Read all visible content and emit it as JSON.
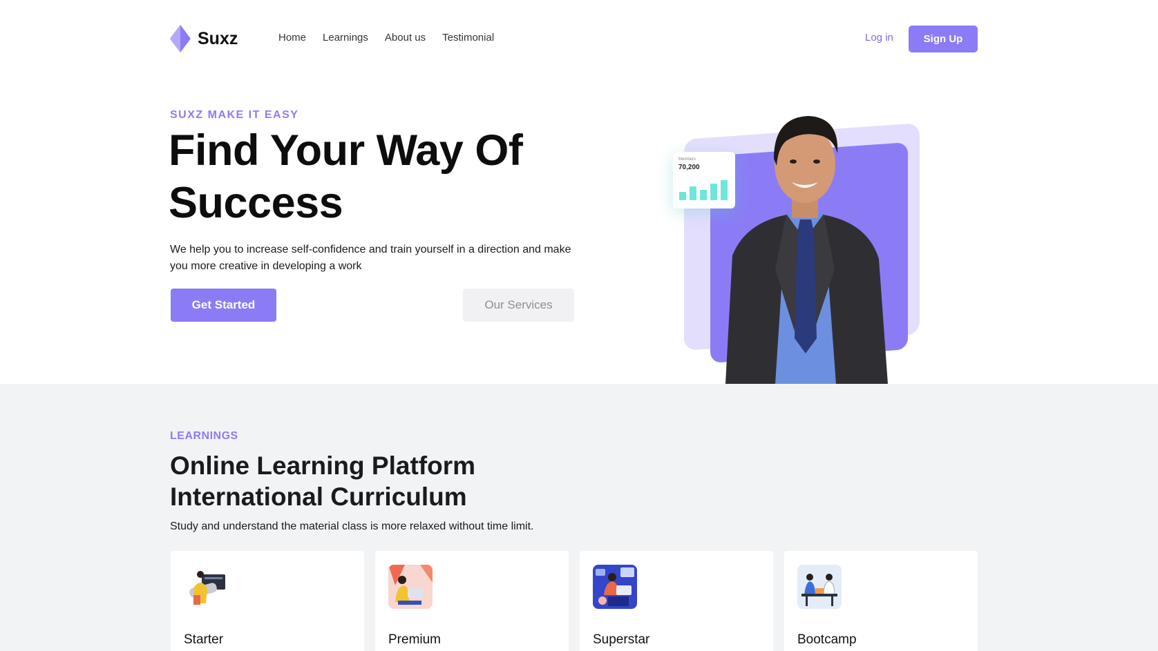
{
  "brand": {
    "name": "Suxz",
    "accent": "#8b7cf6"
  },
  "nav": {
    "links": [
      "Home",
      "Learnings",
      "About us",
      "Testimonial"
    ],
    "login": "Log in",
    "signup": "Sign Up"
  },
  "hero": {
    "eyebrow": "SUXZ MAKE IT EASY",
    "title_line1": "Find Your Way Of",
    "title_line2": "Success",
    "description": "We help you to increase self-confidence and train yourself in a direction and make you more creative in developing a work",
    "primary_button": "Get Started",
    "secondary_button": "Our Services",
    "stat_card": {
      "label": "Members",
      "value": "70,200",
      "bar_levels": [
        0.35,
        0.6,
        0.45,
        0.7,
        0.85
      ]
    }
  },
  "learnings": {
    "eyebrow": "LEARNINGS",
    "title_line1": "Online Learning Platform",
    "title_line2": "International Curriculum",
    "description": "Study and understand the material class is more relaxed without time limit.",
    "cards": [
      {
        "title": "Starter",
        "icon": "starter-illustration-icon"
      },
      {
        "title": "Premium",
        "icon": "premium-illustration-icon"
      },
      {
        "title": "Superstar",
        "icon": "superstar-illustration-icon"
      },
      {
        "title": "Bootcamp",
        "icon": "bootcamp-illustration-icon"
      }
    ]
  }
}
